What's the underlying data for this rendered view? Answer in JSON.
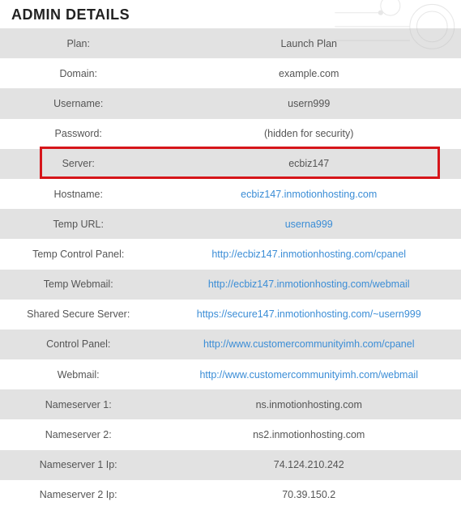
{
  "heading": "ADMIN DETAILS",
  "rows": [
    {
      "label": "Plan:",
      "value": "Launch Plan",
      "link": false
    },
    {
      "label": "Domain:",
      "value": "example.com",
      "link": false
    },
    {
      "label": "Username:",
      "value": "usern999",
      "link": false
    },
    {
      "label": "Password:",
      "value": "(hidden for security)",
      "link": false
    },
    {
      "label": "Server:",
      "value": "ecbiz147",
      "link": false
    },
    {
      "label": "Hostname:",
      "value": "ecbiz147.inmotionhosting.com",
      "link": true
    },
    {
      "label": "Temp URL:",
      "value": "userna999",
      "link": true
    },
    {
      "label": "Temp Control Panel:",
      "value": "http://ecbiz147.inmotionhosting.com/cpanel",
      "link": true
    },
    {
      "label": "Temp Webmail:",
      "value": "http://ecbiz147.inmotionhosting.com/webmail",
      "link": true
    },
    {
      "label": "Shared Secure Server:",
      "value": "https://secure147.inmotionhosting.com/~usern999",
      "link": true
    },
    {
      "label": "Control Panel:",
      "value": "http://www.customercommunityimh.com/cpanel",
      "link": true
    },
    {
      "label": "Webmail:",
      "value": "http://www.customercommunityimh.com/webmail",
      "link": true
    },
    {
      "label": "Nameserver 1:",
      "value": "ns.inmotionhosting.com",
      "link": false
    },
    {
      "label": "Nameserver 2:",
      "value": "ns2.inmotionhosting.com",
      "link": false
    },
    {
      "label": "Nameserver 1 Ip:",
      "value": "74.124.210.242",
      "link": false
    },
    {
      "label": "Nameserver 2 Ip:",
      "value": "70.39.150.2",
      "link": false
    }
  ],
  "highlight_row_index": 4
}
